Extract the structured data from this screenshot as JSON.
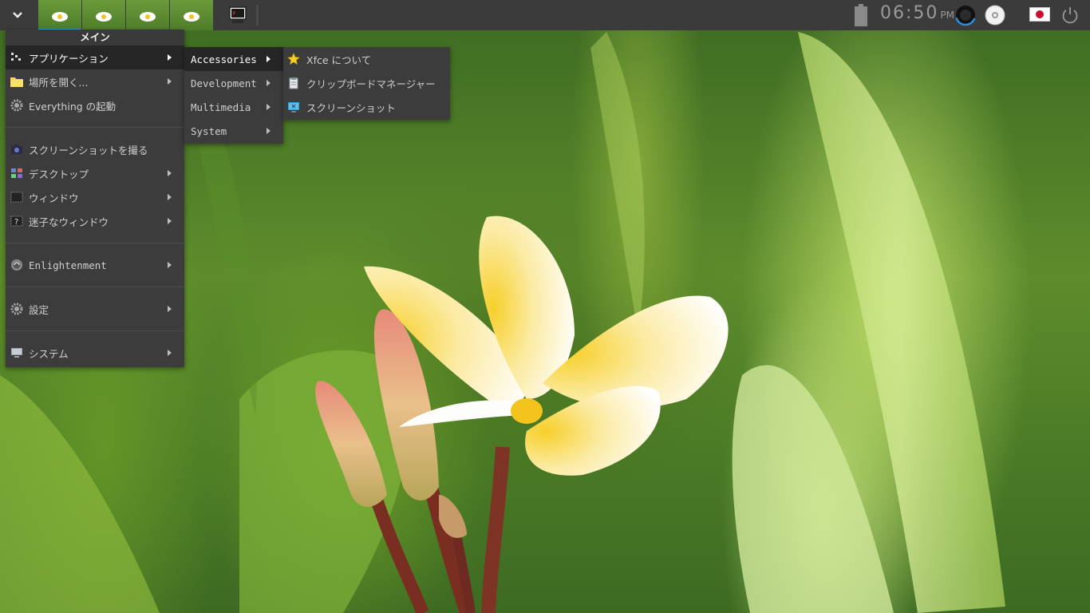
{
  "panel": {
    "clock_time": "06:50",
    "clock_ampm": "PM",
    "workspaces": [
      "ws1",
      "ws2",
      "ws3",
      "ws4"
    ],
    "active_workspace": 1
  },
  "main_menu": {
    "title": "メイン",
    "items": [
      {
        "label": "アプリケーション",
        "icon": "applications-icon",
        "submenu": true,
        "selected": true
      },
      {
        "label": "場所を開く...",
        "icon": "folder-icon",
        "submenu": true
      },
      {
        "label": "Everything の起動",
        "icon": "gear-icon",
        "submenu": false
      },
      {
        "label": "スクリーンショットを撮る",
        "icon": "camera-icon",
        "submenu": false
      },
      {
        "label": "デスクトップ",
        "icon": "desktop-icon",
        "submenu": true
      },
      {
        "label": "ウィンドウ",
        "icon": "window-icon",
        "submenu": true
      },
      {
        "label": "迷子なウィンドウ",
        "icon": "lost-window-icon",
        "submenu": true
      },
      {
        "label": "Enlightenment",
        "icon": "enlightenment-icon",
        "submenu": true
      },
      {
        "label": "設定",
        "icon": "settings-gear-icon",
        "submenu": true
      },
      {
        "label": "システム",
        "icon": "computer-icon",
        "submenu": true
      }
    ]
  },
  "apps_submenu": {
    "items": [
      {
        "label": "Accessories",
        "selected": true
      },
      {
        "label": "Development"
      },
      {
        "label": "Multimedia"
      },
      {
        "label": "System"
      }
    ]
  },
  "accessories_submenu": {
    "items": [
      {
        "label": "Xfce について",
        "icon": "star-icon"
      },
      {
        "label": "クリップボードマネージャー",
        "icon": "clipboard-icon"
      },
      {
        "label": "スクリーンショット",
        "icon": "screenshot-icon"
      }
    ]
  }
}
